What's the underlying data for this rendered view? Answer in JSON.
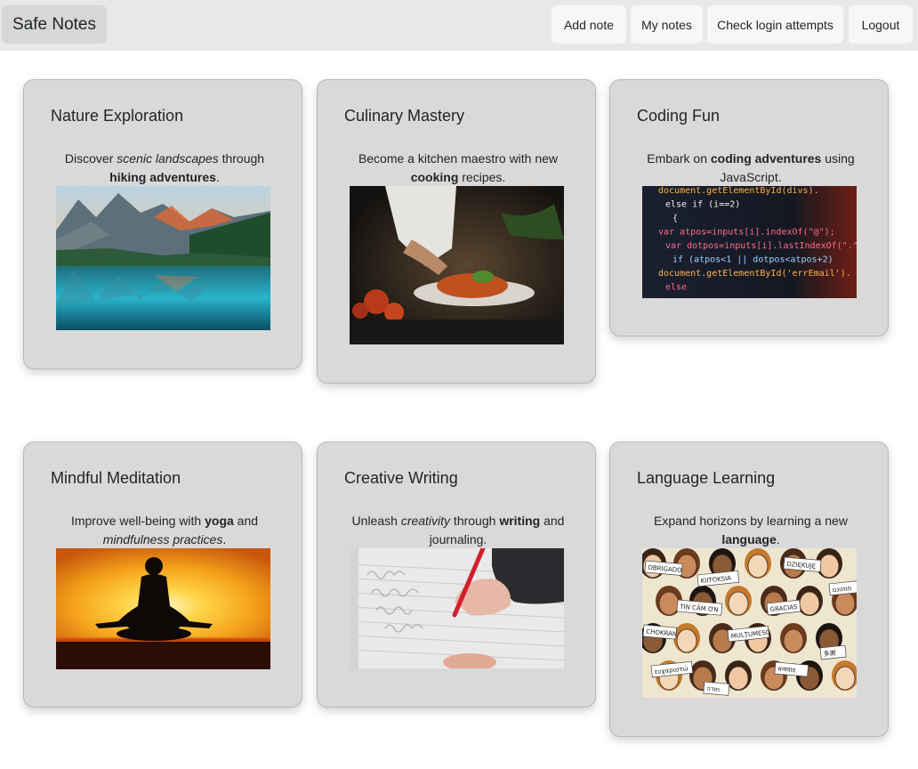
{
  "navbar": {
    "brand": "Safe Notes",
    "links": [
      "Add note",
      "My notes",
      "Check login attempts",
      "Logout"
    ]
  },
  "cards": [
    {
      "title": "Nature Exploration",
      "desc": [
        {
          "t": "Discover ",
          "s": "normal"
        },
        {
          "t": "scenic landscapes",
          "s": "italic"
        },
        {
          "t": " through ",
          "s": "normal"
        },
        {
          "t": "hiking adventures",
          "s": "bold"
        },
        {
          "t": ".",
          "s": "normal"
        }
      ],
      "image": "mountain-lake"
    },
    {
      "title": "Culinary Mastery",
      "desc": [
        {
          "t": "Become a kitchen maestro with new ",
          "s": "normal"
        },
        {
          "t": "cooking",
          "s": "bold"
        },
        {
          "t": " recipes.",
          "s": "normal"
        }
      ],
      "image": "chef-pasta"
    },
    {
      "title": "Coding Fun",
      "desc": [
        {
          "t": "Embark on ",
          "s": "normal"
        },
        {
          "t": "coding adventures",
          "s": "bold"
        },
        {
          "t": " using JavaScript.",
          "s": "normal"
        }
      ],
      "image": "code-screen",
      "code_lines": [
        "document.getElementById(divs).",
        "else if (i==2)",
        "{",
        "var atpos=inputs[i].indexOf(\"@\");",
        "var dotpos=inputs[i].lastIndexOf(\".\");",
        "if (atpos<1 || dotpos<atpos+2)",
        "document.getElementById('errEmail').",
        "else"
      ]
    },
    {
      "title": "Mindful Meditation",
      "desc": [
        {
          "t": "Improve well-being with ",
          "s": "normal"
        },
        {
          "t": "yoga",
          "s": "bold"
        },
        {
          "t": " and ",
          "s": "normal"
        },
        {
          "t": "mindfulness practices",
          "s": "italic"
        },
        {
          "t": ".",
          "s": "normal"
        }
      ],
      "image": "meditation-sunset"
    },
    {
      "title": "Creative Writing",
      "desc": [
        {
          "t": "Unleash ",
          "s": "normal"
        },
        {
          "t": "creativity",
          "s": "italic"
        },
        {
          "t": " through ",
          "s": "normal"
        },
        {
          "t": "writing",
          "s": "bold"
        },
        {
          "t": " and journaling.",
          "s": "normal"
        }
      ],
      "image": "handwriting-notebook"
    },
    {
      "title": "Language Learning",
      "desc": [
        {
          "t": "Expand horizons by learning a new ",
          "s": "normal"
        },
        {
          "t": "language",
          "s": "bold"
        },
        {
          "t": ".",
          "s": "normal"
        }
      ],
      "image": "language-people",
      "signs": [
        "OBRIGADO",
        "KIITOKSIA",
        "DZIĘKUJĘ",
        "ממנונם",
        "TIN CẢM ƠN",
        "GRACIAS",
        "CHOKRAN",
        "MULŢUMESC",
        "धन्यवाद",
        "多謝",
        "תודה",
        "ευχαριστώ"
      ]
    }
  ],
  "colors": {
    "navbar_bg": "#e7e8e8",
    "brand_bg": "#d6d7d7",
    "button_bg": "#f7f7f7",
    "card_bg": "#d9d9d9"
  }
}
